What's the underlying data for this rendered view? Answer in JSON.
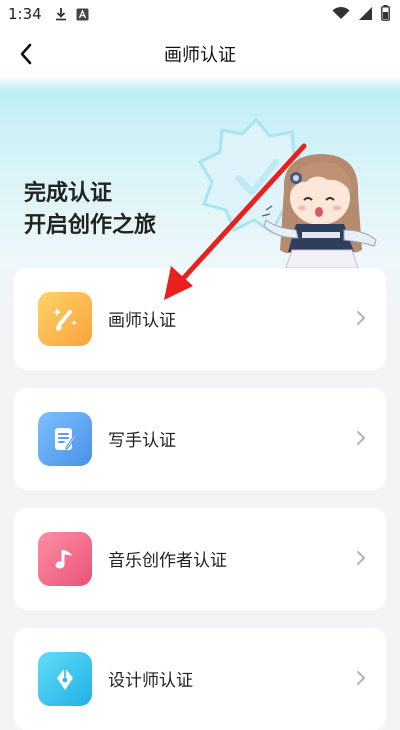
{
  "status_bar": {
    "time": "1:34",
    "icons": [
      "download-icon",
      "text-a-icon",
      "wifi-icon",
      "signal-icon",
      "battery-icon"
    ]
  },
  "header": {
    "title": "画师认证",
    "back_icon": "chevron-left-icon"
  },
  "hero": {
    "line1": "完成认证",
    "line2": "开启创作之旅"
  },
  "cards": [
    {
      "label": "画师认证",
      "icon": "brush-sparkle-icon",
      "color": "#fbb040"
    },
    {
      "label": "写手认证",
      "icon": "document-pen-icon",
      "color": "#5aa8f2"
    },
    {
      "label": "音乐创作者认证",
      "icon": "music-note-icon",
      "color": "#f06a8a"
    },
    {
      "label": "设计师认证",
      "icon": "pen-nib-icon",
      "color": "#3cc8ef"
    }
  ],
  "colors": {
    "hero_gradient": "#bfeef6",
    "annotation_arrow": "#e8211f"
  }
}
